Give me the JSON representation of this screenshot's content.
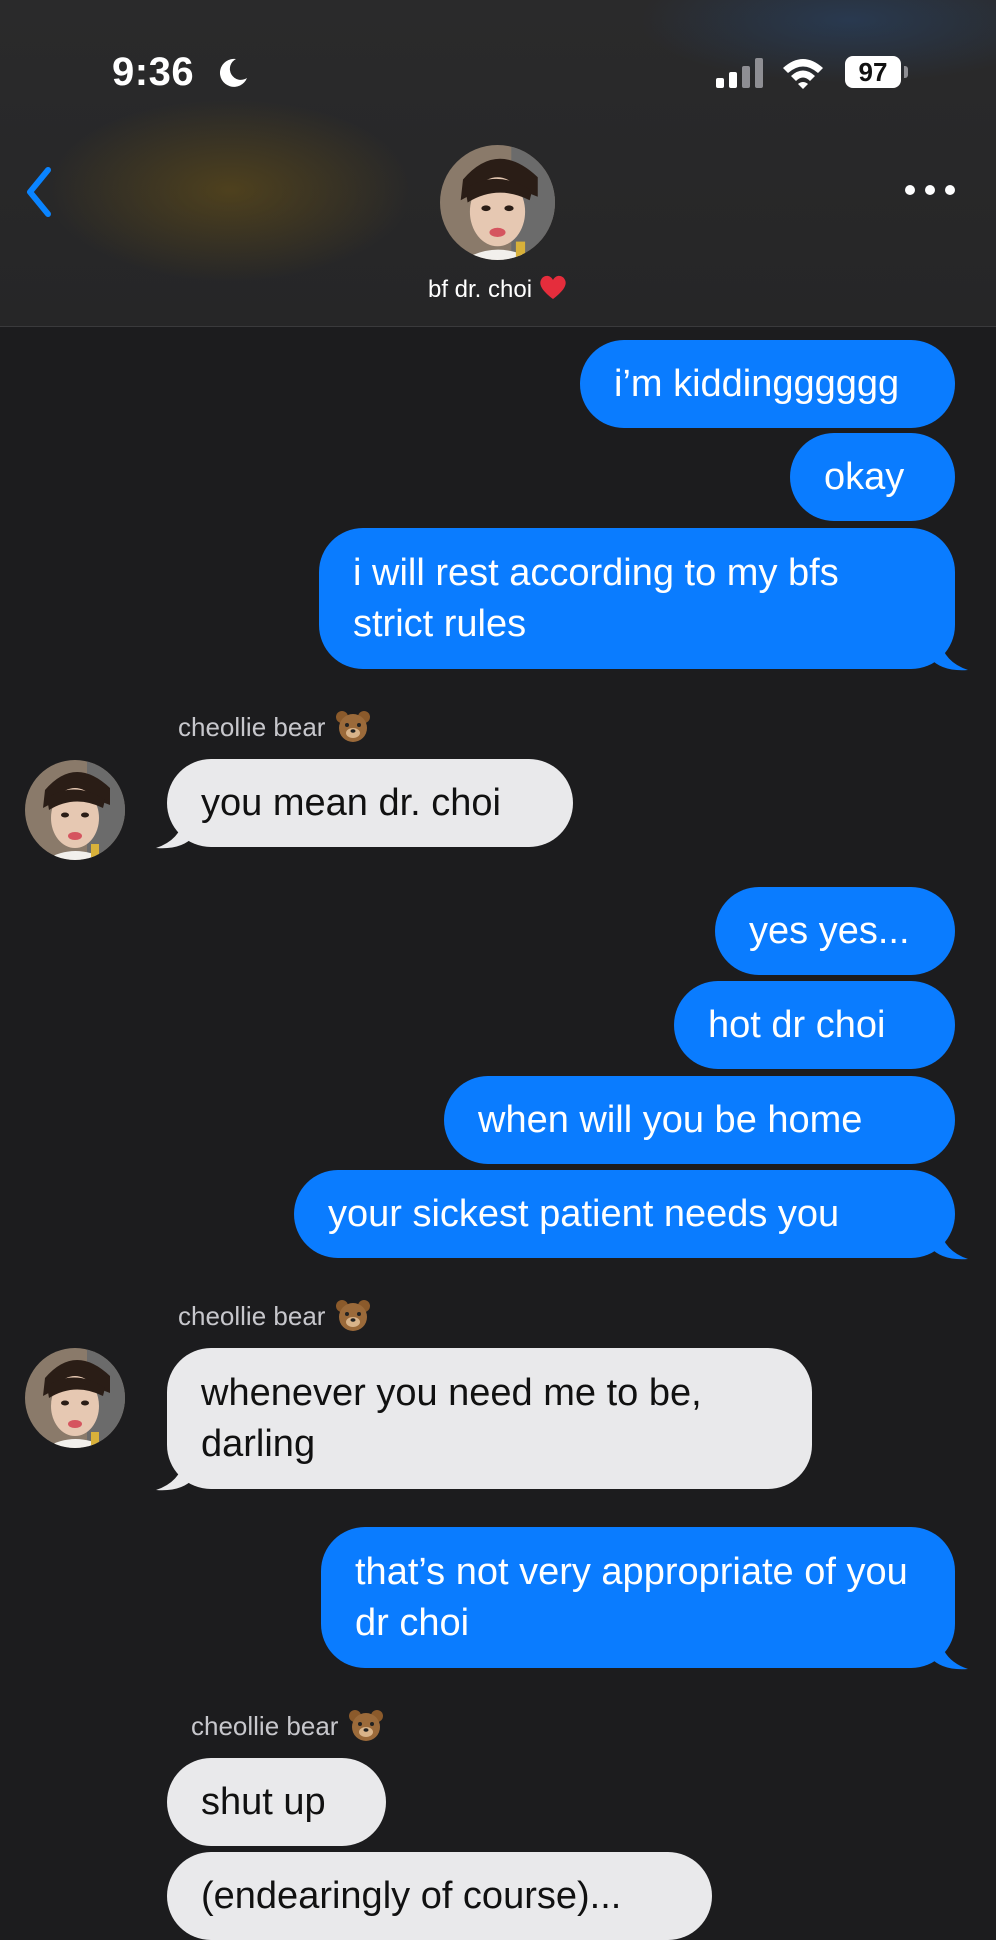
{
  "status_bar": {
    "time": "9:36",
    "battery": "97"
  },
  "header": {
    "contact_name": "bf dr. choi"
  },
  "colors": {
    "outgoing": "#0a7cff",
    "incoming": "#e9e9eb",
    "background": "#1c1c1e",
    "accent": "#0a84ff"
  },
  "messages": [
    {
      "direction": "out",
      "text": "i’m kiddingggggg"
    },
    {
      "direction": "out",
      "text": "okay"
    },
    {
      "direction": "out",
      "text": "i will rest according to my bfs strict rules"
    },
    {
      "direction": "in",
      "sender": "cheollie bear",
      "text": "you mean dr. choi"
    },
    {
      "direction": "out",
      "text": "yes yes..."
    },
    {
      "direction": "out",
      "text": "hot dr choi"
    },
    {
      "direction": "out",
      "text": "when will you be home"
    },
    {
      "direction": "out",
      "text": "your sickest patient needs you"
    },
    {
      "direction": "in",
      "sender": "cheollie bear",
      "text": "whenever you need me to be, darling"
    },
    {
      "direction": "out",
      "text": "that’s not very appropriate of you dr choi"
    },
    {
      "direction": "in",
      "sender": "cheollie bear",
      "text": "shut up"
    },
    {
      "direction": "in",
      "text": "(endearingly of course)..."
    }
  ]
}
